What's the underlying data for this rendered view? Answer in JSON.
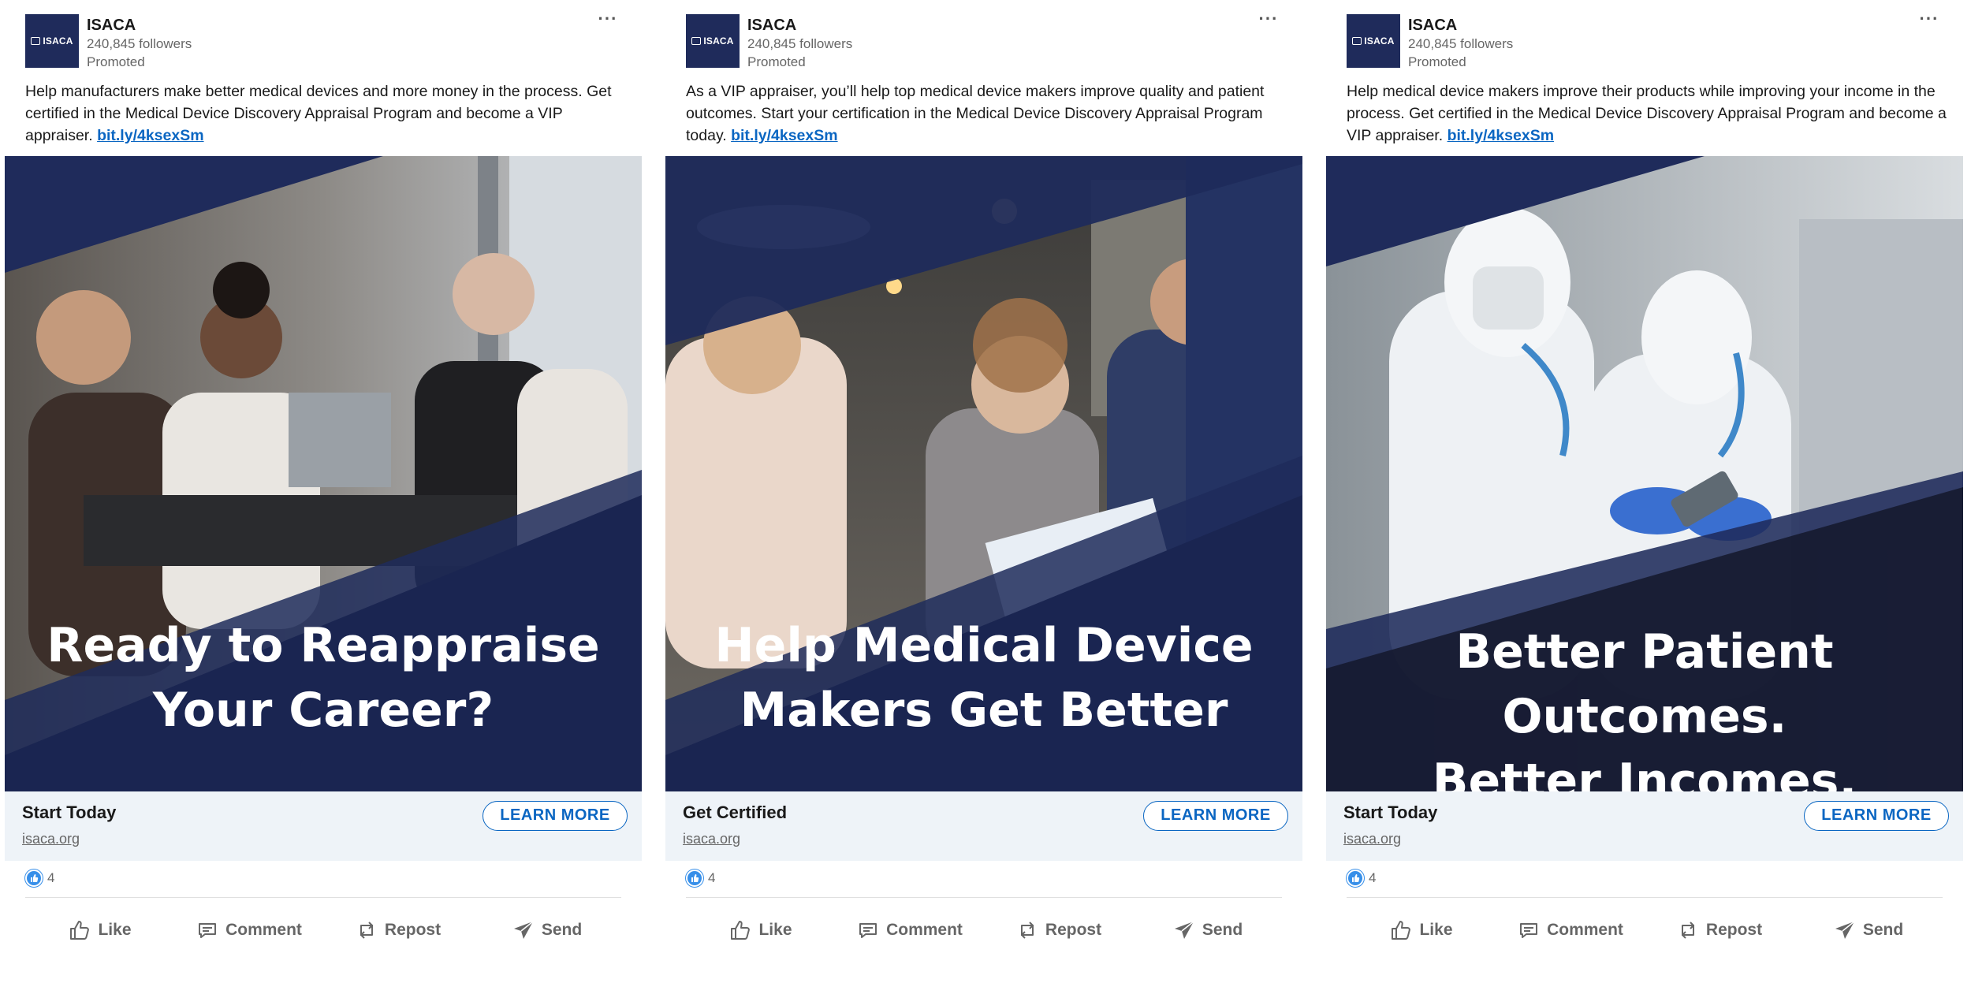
{
  "colors": {
    "brand_navy": "#1f2b5b",
    "link_blue": "#0a66c2",
    "cta_bar": "#eef3f8",
    "reaction_blue": "#378fe9"
  },
  "posts": [
    {
      "author": {
        "name": "ISACA",
        "followers": "240,845 followers",
        "promoted": "Promoted",
        "logo_text": "ISACA"
      },
      "more_icon": "ellipsis-icon",
      "more_label": "···",
      "commentary": "Help manufacturers make better medical devices and more money in the process. Get certified in the Medical Device Discovery Appraisal Program and become a VIP appraiser. ",
      "link_text": "bit.ly/4ksexSm",
      "headline_line1": "Ready to Reappraise",
      "headline_line2": "Your Career?",
      "image_description_icon": "office-meeting-photo",
      "cta": {
        "title": "Start Today",
        "domain": "isaca.org",
        "button": "LEARN MORE"
      },
      "reactions": {
        "icon": "like-reaction-icon",
        "count": "4"
      },
      "actions": [
        {
          "label": "Like",
          "icon": "thumbs-up-icon"
        },
        {
          "label": "Comment",
          "icon": "comment-icon"
        },
        {
          "label": "Repost",
          "icon": "repost-icon"
        },
        {
          "label": "Send",
          "icon": "send-icon"
        }
      ]
    },
    {
      "author": {
        "name": "ISACA",
        "followers": "240,845 followers",
        "promoted": "Promoted",
        "logo_text": "ISACA"
      },
      "more_icon": "ellipsis-icon",
      "more_label": "···",
      "commentary": "As a VIP appraiser, you’ll help top medical device makers improve quality and patient outcomes. Start your certification in the Medical Device Discovery Appraisal Program today. ",
      "link_text": "bit.ly/4ksexSm",
      "headline_line1": "Help Medical Device",
      "headline_line2": "Makers Get Better",
      "image_description_icon": "team-review-photo",
      "cta": {
        "title": "Get Certified",
        "domain": "isaca.org",
        "button": "LEARN MORE"
      },
      "reactions": {
        "icon": "like-reaction-icon",
        "count": "4"
      },
      "actions": [
        {
          "label": "Like",
          "icon": "thumbs-up-icon"
        },
        {
          "label": "Comment",
          "icon": "comment-icon"
        },
        {
          "label": "Repost",
          "icon": "repost-icon"
        },
        {
          "label": "Send",
          "icon": "send-icon"
        }
      ]
    },
    {
      "author": {
        "name": "ISACA",
        "followers": "240,845 followers",
        "promoted": "Promoted",
        "logo_text": "ISACA"
      },
      "more_icon": "ellipsis-icon",
      "more_label": "···",
      "commentary": "Help medical device makers improve their products while improving your income in the process. Get certified in the Medical Device Discovery Appraisal Program and become a VIP appraiser. ",
      "link_text": "bit.ly/4ksexSm",
      "headline_line1": "Better Patient Outcomes.",
      "headline_line2": "Better Incomes.",
      "image_description_icon": "lab-cleanroom-photo",
      "cta": {
        "title": "Start Today",
        "domain": "isaca.org",
        "button": "LEARN MORE"
      },
      "reactions": {
        "icon": "like-reaction-icon",
        "count": "4"
      },
      "actions": [
        {
          "label": "Like",
          "icon": "thumbs-up-icon"
        },
        {
          "label": "Comment",
          "icon": "comment-icon"
        },
        {
          "label": "Repost",
          "icon": "repost-icon"
        },
        {
          "label": "Send",
          "icon": "send-icon"
        }
      ]
    }
  ]
}
